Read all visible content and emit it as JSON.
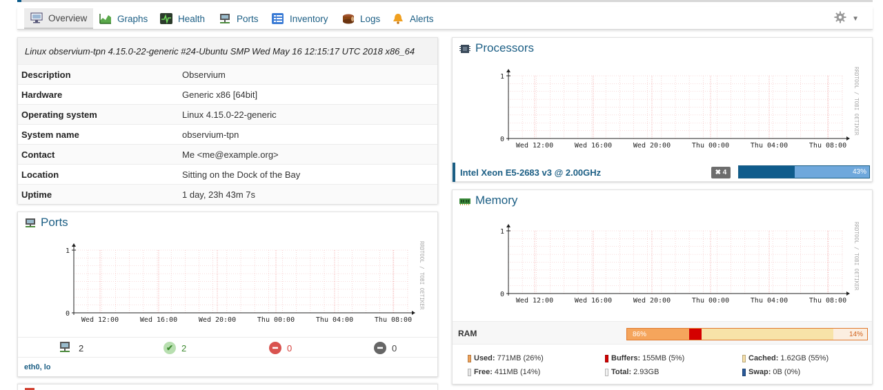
{
  "nav": {
    "items": [
      {
        "label": "Overview",
        "icon": "monitor-icon",
        "active": true
      },
      {
        "label": "Graphs",
        "icon": "area-chart-icon"
      },
      {
        "label": "Health",
        "icon": "pulse-icon"
      },
      {
        "label": "Ports",
        "icon": "network-port-icon"
      },
      {
        "label": "Inventory",
        "icon": "list-icon"
      },
      {
        "label": "Logs",
        "icon": "logs-icon"
      },
      {
        "label": "Alerts",
        "icon": "bell-icon"
      }
    ],
    "settings_icon": "gear-icon"
  },
  "overview": {
    "header": "Linux observium-tpn 4.15.0-22-generic #24-Ubuntu SMP Wed May 16 12:15:17 UTC 2018 x86_64",
    "rows": [
      {
        "key": "Description",
        "value": "Observium"
      },
      {
        "key": "Hardware",
        "value": "Generic x86 [64bit]"
      },
      {
        "key": "Operating system",
        "value": "Linux 4.15.0-22-generic"
      },
      {
        "key": "System name",
        "value": "observium-tpn"
      },
      {
        "key": "Contact",
        "value": "Me <me@example.org>"
      },
      {
        "key": "Location",
        "value": "Sitting on the Dock of the Bay"
      },
      {
        "key": "Uptime",
        "value": "1 day, 23h 43m 7s"
      }
    ]
  },
  "ports": {
    "title": "Ports",
    "stats": {
      "total": "2",
      "up": "2",
      "down": "0",
      "disabled": "0"
    },
    "list": "eth0, lo"
  },
  "processors": {
    "title": "Processors",
    "name": "Intel Xeon E5-2683 v3 @ 2.00GHz",
    "count_badge": "✖ 4",
    "usage_percent": 43,
    "usage_label": "43%"
  },
  "memory": {
    "title": "Memory",
    "ram_label": "RAM",
    "used_label": "86%",
    "free_label": "14%",
    "legend": [
      {
        "key": "Used:",
        "value": "771MB (26%)",
        "color": "#f0a35a"
      },
      {
        "key": "Buffers:",
        "value": "155MB (5%)",
        "color": "#d40000"
      },
      {
        "key": "Cached:",
        "value": "1.62GB (55%)",
        "color": "#f5dfa8"
      },
      {
        "key": "Free:",
        "value": "411MB (14%)",
        "color": "#e8e8e8"
      },
      {
        "key": "Total:",
        "value": "2.93GB",
        "color": ""
      },
      {
        "key": "Swap:",
        "value": "0B (0%)",
        "color": "#2a5a9a"
      }
    ],
    "segments": [
      {
        "name": "used",
        "percent": 26,
        "color": "#f5a55c"
      },
      {
        "name": "buffers",
        "percent": 5,
        "color": "#d40000"
      },
      {
        "name": "cached",
        "percent": 55,
        "color": "#f7e3a8"
      }
    ]
  },
  "graph": {
    "watermark": "RRDTOOL / TOBI OETIKER",
    "yticks": [
      "1",
      "0"
    ],
    "xticks": [
      "Wed 12:00",
      "Wed 16:00",
      "Wed 20:00",
      "Thu 00:00",
      "Thu 04:00",
      "Thu 08:00"
    ]
  },
  "colors": {
    "accent": "#1b5e84",
    "ok": "#5cb85c",
    "down": "#d9534f",
    "disabled": "#666666"
  }
}
